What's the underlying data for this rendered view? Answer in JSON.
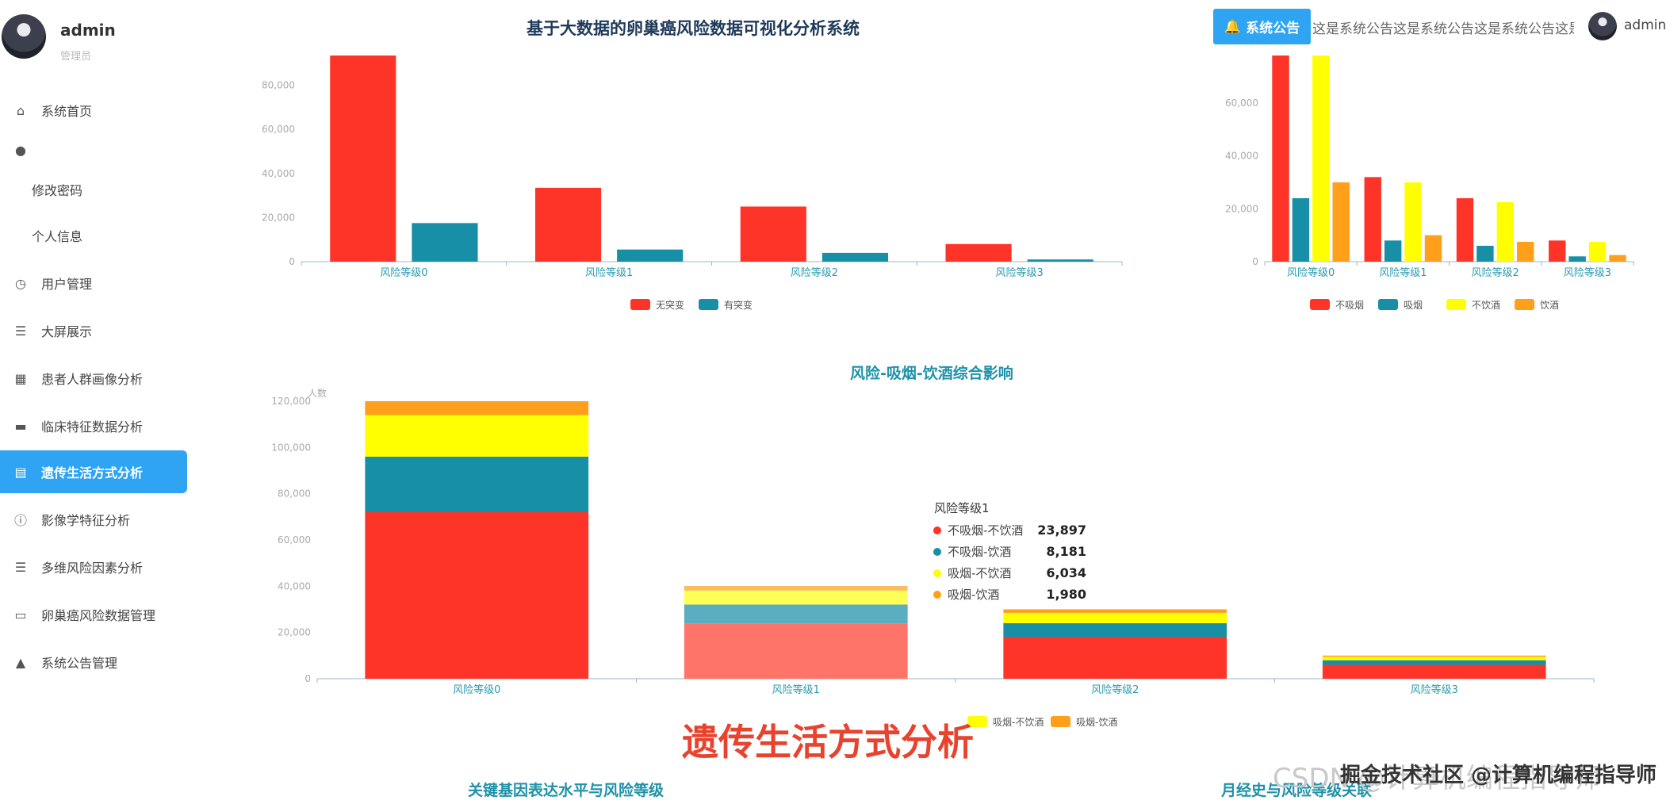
{
  "app": {
    "title": "基于大数据的卵巢癌风险数据可视化分析系统"
  },
  "user": {
    "name": "admin",
    "role": "管理员"
  },
  "sidebar": {
    "items": [
      {
        "label": "系统首页",
        "icon": "home-icon"
      },
      {
        "label": "",
        "icon": "user-icon"
      },
      {
        "label": "修改密码",
        "icon": ""
      },
      {
        "label": "个人信息",
        "icon": ""
      },
      {
        "label": "用户管理",
        "icon": "clock-icon"
      },
      {
        "label": "大屏展示",
        "icon": "list-icon"
      },
      {
        "label": "患者人群画像分析",
        "icon": "grid-icon"
      },
      {
        "label": "临床特征数据分析",
        "icon": "monitor-icon"
      },
      {
        "label": "遗传生活方式分析",
        "icon": "window-icon"
      },
      {
        "label": "影像学特征分析",
        "icon": "info-icon"
      },
      {
        "label": "多维风险因素分析",
        "icon": "list-icon"
      },
      {
        "label": "卵巢癌风险数据管理",
        "icon": "chat-icon"
      },
      {
        "label": "系统公告管理",
        "icon": "person-icon"
      }
    ],
    "active_label": "遗传生活方式分析"
  },
  "header": {
    "notice_label": "系统公告",
    "notice_text": "这是系统公告这是系统公告这是系统公告这是系统公告",
    "user": "admin"
  },
  "sections": {
    "combined_title": "风险-吸烟-饮酒综合影响",
    "gene_title": "关键基因表达水平与风险等级",
    "menstrual_title": "月经史与风险等级关联"
  },
  "overlay": {
    "caption": "遗传生活方式分析",
    "watermark": "CSDN @计算机编程指导师",
    "watermark_fg": "掘金技术社区 @计算机编程指导师"
  },
  "colors": {
    "red": "#ff3428",
    "teal": "#178fa6",
    "yellow": "#ffff00",
    "orange": "#ff9f1a",
    "accent": "#2fa4f2"
  },
  "chart_data": [
    {
      "type": "bar",
      "categories": [
        "风险等级0",
        "风险等级1",
        "风险等级2",
        "风险等级3"
      ],
      "series": [
        {
          "name": "无突变",
          "values": [
            93500,
            33500,
            25000,
            8000
          ]
        },
        {
          "name": "有突变",
          "values": [
            17500,
            5500,
            4000,
            1000
          ]
        }
      ],
      "yticks": [
        "0",
        "20,000",
        "40,000",
        "60,000",
        "80,000"
      ],
      "ylim": [
        0,
        93500
      ],
      "legend": "bottom"
    },
    {
      "type": "bar",
      "categories": [
        "风险等级0",
        "风险等级1",
        "风险等级2",
        "风险等级3"
      ],
      "series": [
        {
          "name": "不吸烟",
          "values": [
            78000,
            32000,
            24000,
            8000
          ]
        },
        {
          "name": "吸烟",
          "values": [
            24000,
            8000,
            6000,
            2000
          ]
        },
        {
          "name": "不饮酒",
          "values": [
            78000,
            30000,
            22500,
            7500
          ]
        },
        {
          "name": "饮酒",
          "values": [
            30000,
            10000,
            7500,
            2500
          ]
        }
      ],
      "yticks": [
        "0",
        "20,000",
        "40,000",
        "60,000"
      ],
      "ylim": [
        0,
        78000
      ],
      "legend": "bottom"
    },
    {
      "type": "bar",
      "stacked": true,
      "title": "风险-吸烟-饮酒综合影响",
      "ylabel": "人数",
      "categories": [
        "风险等级0",
        "风险等级1",
        "风险等级2",
        "风险等级3"
      ],
      "series": [
        {
          "name": "不吸烟-不饮酒",
          "values": [
            72000,
            23897,
            18000,
            6000
          ]
        },
        {
          "name": "不吸烟-饮酒",
          "values": [
            24000,
            8181,
            6000,
            2000
          ]
        },
        {
          "name": "吸烟-不饮酒",
          "values": [
            18000,
            6034,
            4500,
            1500
          ]
        },
        {
          "name": "吸烟-饮酒",
          "values": [
            6000,
            1980,
            1500,
            500
          ]
        }
      ],
      "yticks": [
        "0",
        "20,000",
        "40,000",
        "60,000",
        "80,000",
        "100,000",
        "120,000"
      ],
      "ylim": [
        0,
        120000
      ],
      "legend": "bottom",
      "legend_visible": [
        "吸烟-不饮酒",
        "吸烟-饮酒"
      ],
      "tooltip": {
        "title": "风险等级1",
        "rows": [
          {
            "label": "不吸烟-不饮酒",
            "value": "23,897"
          },
          {
            "label": "不吸烟-饮酒",
            "value": "8,181"
          },
          {
            "label": "吸烟-不饮酒",
            "value": "6,034"
          },
          {
            "label": "吸烟-饮酒",
            "value": "1,980"
          }
        ]
      }
    }
  ]
}
